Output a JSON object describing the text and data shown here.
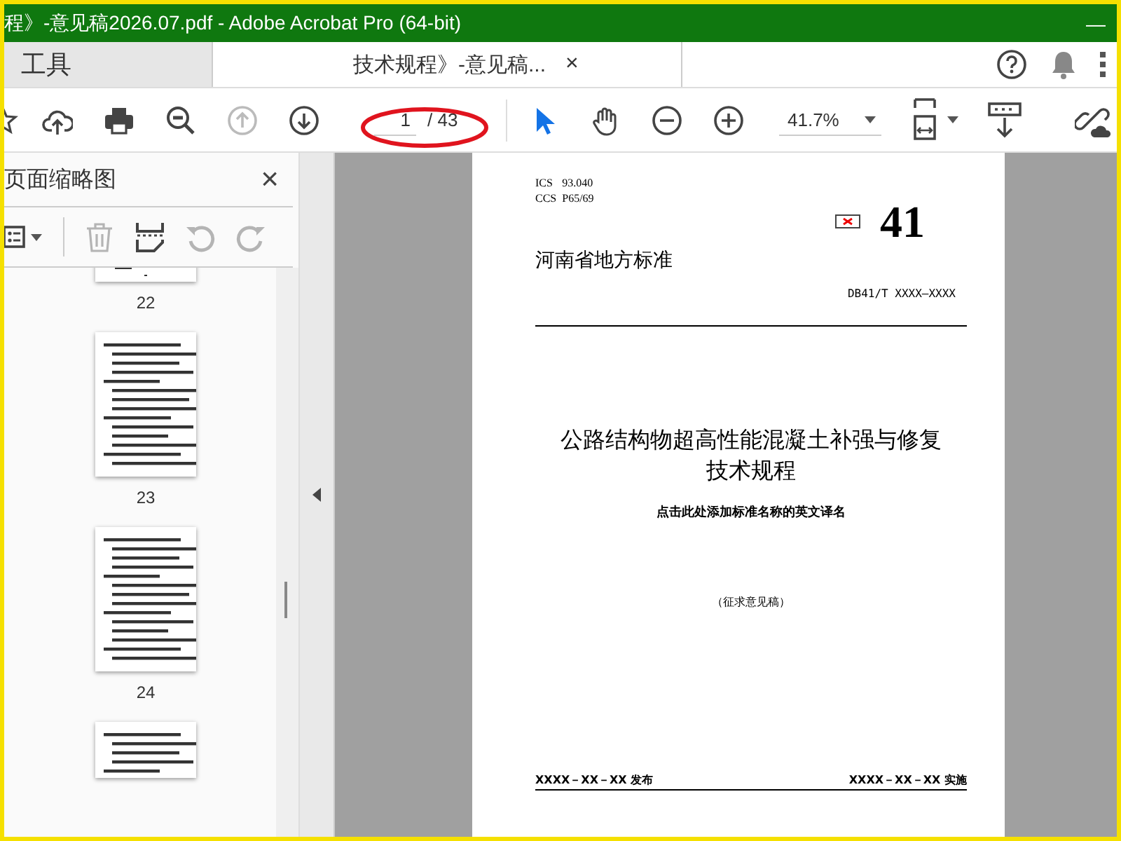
{
  "window": {
    "title": "程》-意见稿2026.07.pdf - Adobe Acrobat Pro (64-bit)",
    "minimize": "—"
  },
  "tabs": [
    {
      "label": "工具",
      "selected": false
    },
    {
      "label": "技术规程》-意见稿...",
      "selected": true,
      "close": "×"
    }
  ],
  "toolbar": {
    "nav": [
      {
        "kind": "up",
        "disabled": true
      },
      {
        "kind": "down",
        "disabled": false
      }
    ],
    "page_field": {
      "value": "1"
    },
    "page_total": "/ 43",
    "tools": [
      {
        "kind": "select",
        "selected": true
      },
      {
        "kind": "hand",
        "selected": false
      }
    ],
    "zoom": "41.7%",
    "annotation": {
      "kind": "ellipse",
      "color": "#e0141e"
    }
  },
  "sidebar": {
    "title": "页面缩略图",
    "close": "×",
    "tools": [
      {
        "kind": "trash",
        "disabled": true
      },
      {
        "kind": "insert",
        "disabled": false
      },
      {
        "kind": "rotate-left",
        "disabled": true
      },
      {
        "kind": "rotate-right",
        "disabled": true
      }
    ],
    "thumbnails": [
      {
        "kind": "top-cut",
        "label": "22"
      },
      {
        "kind": "full",
        "label": "23"
      },
      {
        "kind": "full",
        "label": "24"
      },
      {
        "kind": "bottom-cut"
      }
    ]
  },
  "page": {
    "ics": "ICS",
    "ics_code": "93.040",
    "ccs": "CCS",
    "ccs_code": "P65/69",
    "number": "41",
    "authority": "河南省地方标准",
    "code": "DB41/T XXXX—XXXX",
    "title_lines": [
      "公路结构物超高性能混凝土补强与修复",
      "技术规程"
    ],
    "english_title": "点击此处添加标准名称的英文译名",
    "stage": "（征求意见稿）",
    "issued": "XXXX－XX－XX 发布",
    "effective": "XXXX－XX－XX 实施"
  }
}
